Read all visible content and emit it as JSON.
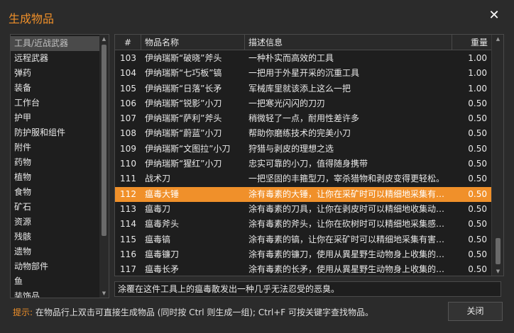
{
  "window": {
    "title": "生成物品",
    "close_icon": "close-icon"
  },
  "categories": {
    "selected": "工具/近战武器",
    "items": [
      "工具/近战武器",
      "远程武器",
      "弹药",
      "装备",
      "工作台",
      "护甲",
      "防护服和组件",
      "附件",
      "药物",
      "植物",
      "食物",
      "矿石",
      "资源",
      "残骸",
      "遗物",
      "动物部件",
      "鱼",
      "装饰品"
    ]
  },
  "table": {
    "headers": {
      "num": "#",
      "name": "物品名称",
      "desc": "描述信息",
      "weight": "重量"
    },
    "selected_id": "112",
    "rows": [
      {
        "id": "103",
        "name": "伊纳瑞斯“破晓”斧头",
        "desc": "一种朴实而高效的工具",
        "weight": "1.00"
      },
      {
        "id": "104",
        "name": "伊纳瑞斯“七巧板”镐",
        "desc": "一把用于外星开采的沉重工具",
        "weight": "1.00"
      },
      {
        "id": "105",
        "name": "伊纳瑞斯“日落”长矛",
        "desc": "军械库里就该添上这么一把",
        "weight": "1.00"
      },
      {
        "id": "106",
        "name": "伊纳瑞斯“锐影”小刀",
        "desc": "一把寒光闪闪的刀刃",
        "weight": "0.50"
      },
      {
        "id": "107",
        "name": "伊纳瑞斯“萨利”斧头",
        "desc": "稍微轻了一点，耐用性差许多",
        "weight": "0.50"
      },
      {
        "id": "108",
        "name": "伊纳瑞斯“蔚蓝”小刀",
        "desc": "帮助你磨练技术的完美小刀",
        "weight": "0.50"
      },
      {
        "id": "109",
        "name": "伊纳瑞斯“文图拉”小刀",
        "desc": "狩猎与剥皮的理想之选",
        "weight": "0.50"
      },
      {
        "id": "110",
        "name": "伊纳瑞斯“猩红”小刀",
        "desc": "忠实可靠的小刀，值得随身携带",
        "weight": "0.50"
      },
      {
        "id": "111",
        "name": "战术刀",
        "desc": "一把坚固的丰箍型刀，宰杀猎物和剥皮变得更轻松。",
        "weight": "0.50"
      },
      {
        "id": "112",
        "name": "瘟毒大锤",
        "desc": "涂有毒素的大锤，让你在采矿时可以精细地采集有害物质",
        "weight": "0.50"
      },
      {
        "id": "113",
        "name": "瘟毒刀",
        "desc": "涂有毒素的刀具，让你在剥皮时可以精细地收集动物毒素",
        "weight": "0.50"
      },
      {
        "id": "114",
        "name": "瘟毒斧头",
        "desc": "涂有毒素的斧头，让你在砍树时可以精细地采集感染物质",
        "weight": "0.50"
      },
      {
        "id": "115",
        "name": "瘟毒镐",
        "desc": "涂有毒素的镐，让你在采矿时可以精细地采集有害的物质",
        "weight": "0.50"
      },
      {
        "id": "116",
        "name": "瘟毒镰刀",
        "desc": "涂有毒素的镰刀，使用从異星野生动物身上收集的瘟毒素",
        "weight": "0.50"
      },
      {
        "id": "117",
        "name": "瘟毒长矛",
        "desc": "涂有毒素的长矛，使用从異星野生动物身上收集的瘟毒素",
        "weight": "0.50"
      }
    ]
  },
  "description": "涂覆在这件工具上的瘟毒散发出一种几乎无法忍受的恶臭。",
  "footer": {
    "hint_label": "提示:",
    "hint_text": "在物品行上双击可直接生成物品 (同时按 Ctrl 则生成一组); Ctrl+F 可按关键字查找物品。",
    "close_button": "关闭"
  },
  "colors": {
    "accent": "#f0902a",
    "background": "#2b2b2b",
    "panel": "#1e1e1e"
  }
}
